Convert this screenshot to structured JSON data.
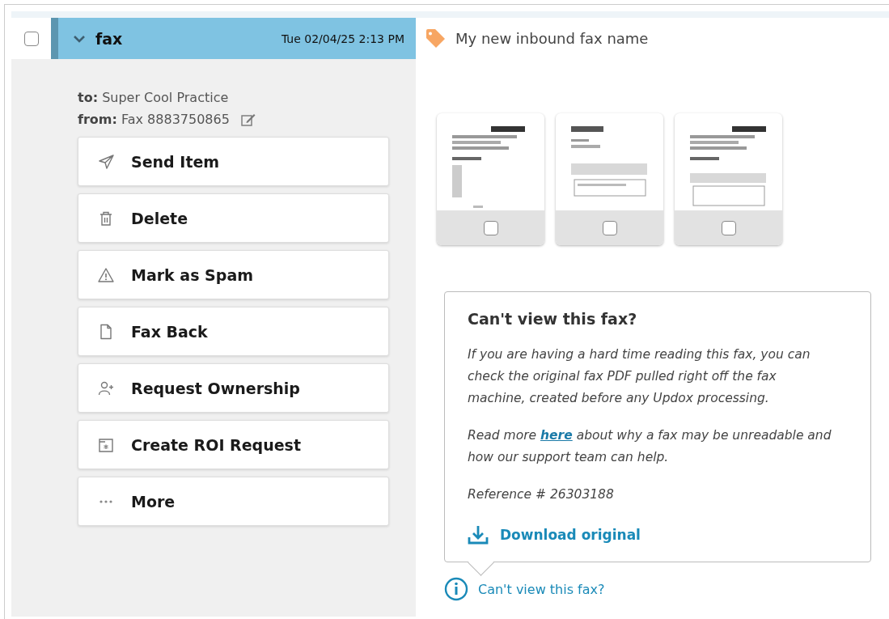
{
  "item": {
    "checked": false,
    "expanded": true,
    "title": "fax",
    "date": "Tue 02/04/25 2:13 PM"
  },
  "fax_name": "My new inbound fax name",
  "meta": {
    "to": "**to:** Super Cool Practice",
    "from": "**from:** Fax 8883750865"
  },
  "actions": [
    {
      "kind": "send",
      "label": "Send Item"
    },
    {
      "kind": "delete",
      "label": "Delete"
    },
    {
      "kind": "spam",
      "label": "Mark as Spam"
    },
    {
      "kind": "document",
      "label": "Fax Back"
    },
    {
      "kind": "ownership",
      "label": "Request Ownership"
    },
    {
      "kind": "roi",
      "label": "Create ROI Request"
    },
    {
      "kind": "more",
      "label": "More"
    }
  ],
  "pages": [
    {
      "checked": false
    },
    {
      "checked": false
    },
    {
      "checked": false
    }
  ],
  "help_popover": {
    "title": "Can't view this fax?",
    "paragraph_1": "If you are having a hard time reading this fax, you can check the original fax PDF pulled right off the fax machine, created before any Updox processing.",
    "paragraph_2_before": "Read more ",
    "paragraph_2_link": "here",
    "paragraph_2_after": " about why a fax may be unreadable and how our support team can help.",
    "reference": "Reference # 26303188",
    "download": "Download original"
  },
  "help_link": "Can't view this fax?"
}
